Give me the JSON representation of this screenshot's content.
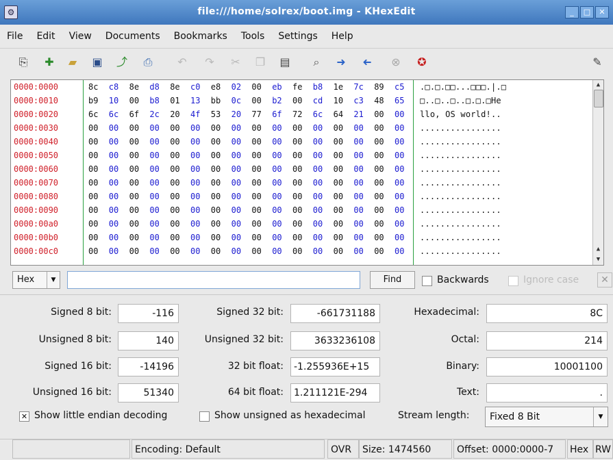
{
  "window": {
    "title": "file:///home/solrex/boot.img - KHexEdit",
    "app_icon": "khexedit-icon"
  },
  "menu": [
    "File",
    "Edit",
    "View",
    "Documents",
    "Bookmarks",
    "Tools",
    "Settings",
    "Help"
  ],
  "toolbar": {
    "icons": [
      "new-document-icon",
      "new-icon",
      "open-folder-icon",
      "save-icon",
      "save-as-icon",
      "print-icon",
      "undo-icon",
      "redo-icon",
      "cut-icon",
      "copy-icon",
      "paste-icon",
      "find-icon",
      "forward-icon",
      "back-icon",
      "stop-icon",
      "help-icon",
      "edit-icon"
    ]
  },
  "hex": {
    "rows": [
      {
        "offset": "0000:0000",
        "bytes": [
          "8c",
          "c8",
          "8e",
          "d8",
          "8e",
          "c0",
          "e8",
          "02",
          "00",
          "eb",
          "fe",
          "b8",
          "1e",
          "7c",
          "89",
          "c5"
        ],
        "ascii": ".□.□.□□...□□□.|.□"
      },
      {
        "offset": "0000:0010",
        "bytes": [
          "b9",
          "10",
          "00",
          "b8",
          "01",
          "13",
          "bb",
          "0c",
          "00",
          "b2",
          "00",
          "cd",
          "10",
          "c3",
          "48",
          "65"
        ],
        "ascii": "□..□..□..□.□.□He"
      },
      {
        "offset": "0000:0020",
        "bytes": [
          "6c",
          "6c",
          "6f",
          "2c",
          "20",
          "4f",
          "53",
          "20",
          "77",
          "6f",
          "72",
          "6c",
          "64",
          "21",
          "00",
          "00"
        ],
        "ascii": "llo, OS world!.."
      },
      {
        "offset": "0000:0030",
        "bytes": [
          "00",
          "00",
          "00",
          "00",
          "00",
          "00",
          "00",
          "00",
          "00",
          "00",
          "00",
          "00",
          "00",
          "00",
          "00",
          "00"
        ],
        "ascii": "................"
      },
      {
        "offset": "0000:0040",
        "bytes": [
          "00",
          "00",
          "00",
          "00",
          "00",
          "00",
          "00",
          "00",
          "00",
          "00",
          "00",
          "00",
          "00",
          "00",
          "00",
          "00"
        ],
        "ascii": "................"
      },
      {
        "offset": "0000:0050",
        "bytes": [
          "00",
          "00",
          "00",
          "00",
          "00",
          "00",
          "00",
          "00",
          "00",
          "00",
          "00",
          "00",
          "00",
          "00",
          "00",
          "00"
        ],
        "ascii": "................"
      },
      {
        "offset": "0000:0060",
        "bytes": [
          "00",
          "00",
          "00",
          "00",
          "00",
          "00",
          "00",
          "00",
          "00",
          "00",
          "00",
          "00",
          "00",
          "00",
          "00",
          "00"
        ],
        "ascii": "................"
      },
      {
        "offset": "0000:0070",
        "bytes": [
          "00",
          "00",
          "00",
          "00",
          "00",
          "00",
          "00",
          "00",
          "00",
          "00",
          "00",
          "00",
          "00",
          "00",
          "00",
          "00"
        ],
        "ascii": "................"
      },
      {
        "offset": "0000:0080",
        "bytes": [
          "00",
          "00",
          "00",
          "00",
          "00",
          "00",
          "00",
          "00",
          "00",
          "00",
          "00",
          "00",
          "00",
          "00",
          "00",
          "00"
        ],
        "ascii": "................"
      },
      {
        "offset": "0000:0090",
        "bytes": [
          "00",
          "00",
          "00",
          "00",
          "00",
          "00",
          "00",
          "00",
          "00",
          "00",
          "00",
          "00",
          "00",
          "00",
          "00",
          "00"
        ],
        "ascii": "................"
      },
      {
        "offset": "0000:00a0",
        "bytes": [
          "00",
          "00",
          "00",
          "00",
          "00",
          "00",
          "00",
          "00",
          "00",
          "00",
          "00",
          "00",
          "00",
          "00",
          "00",
          "00"
        ],
        "ascii": "................"
      },
      {
        "offset": "0000:00b0",
        "bytes": [
          "00",
          "00",
          "00",
          "00",
          "00",
          "00",
          "00",
          "00",
          "00",
          "00",
          "00",
          "00",
          "00",
          "00",
          "00",
          "00"
        ],
        "ascii": "................"
      },
      {
        "offset": "0000:00c0",
        "bytes": [
          "00",
          "00",
          "00",
          "00",
          "00",
          "00",
          "00",
          "00",
          "00",
          "00",
          "00",
          "00",
          "00",
          "00",
          "00",
          "00"
        ],
        "ascii": "................"
      }
    ]
  },
  "search": {
    "mode": "Hex",
    "value": "",
    "find_label": "Find",
    "backwards_label": "Backwards",
    "backwards_checked": false,
    "ignore_case_label": "Ignore case",
    "ignore_case_enabled": false
  },
  "decoding": {
    "fields": [
      {
        "label": "Signed 8 bit:",
        "value": "-116"
      },
      {
        "label": "Unsigned 8 bit:",
        "value": "140"
      },
      {
        "label": "Signed 16 bit:",
        "value": "-14196"
      },
      {
        "label": "Unsigned 16 bit:",
        "value": "51340"
      },
      {
        "label": "Signed 32 bit:",
        "value": "-661731188"
      },
      {
        "label": "Unsigned 32 bit:",
        "value": "3633236108"
      },
      {
        "label": "32 bit float:",
        "value": "-1.255936E+15"
      },
      {
        "label": "64 bit float:",
        "value": "1.211121E-294"
      },
      {
        "label": "Hexadecimal:",
        "value": "8C"
      },
      {
        "label": "Octal:",
        "value": "214"
      },
      {
        "label": "Binary:",
        "value": "10001100"
      },
      {
        "label": "Text:",
        "value": "."
      }
    ],
    "little_endian_label": "Show little endian decoding",
    "little_endian_checked": true,
    "unsigned_hex_label": "Show unsigned as hexadecimal",
    "unsigned_hex_checked": false,
    "stream_length_label": "Stream length:",
    "stream_length_value": "Fixed 8 Bit"
  },
  "status": {
    "encoding": "Encoding: Default",
    "mode": "OVR",
    "size": "Size: 1474560",
    "offset": "Offset: 0000:0000-7",
    "format": "Hex",
    "access": "RW"
  }
}
